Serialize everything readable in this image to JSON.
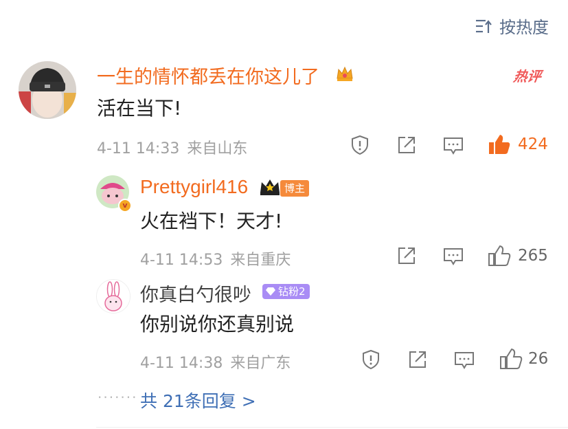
{
  "sort_label": "按热度",
  "main_comment": {
    "username": "一生的情怀都丢在你这儿了",
    "hot_tag": "热评",
    "content": "活在当下!",
    "time": "4-11 14:33",
    "location": "来自山东",
    "likes": "424",
    "accent_color": "#f26b1f"
  },
  "replies": [
    {
      "username": "Prettygirl416",
      "badge": "博主",
      "content": "火在裆下！天才!",
      "time": "4-11 14:53",
      "location": "来自重庆",
      "likes": "265"
    },
    {
      "username": "你真白勺很吵",
      "badge": "钻粉2",
      "content": "你别说你还真别说",
      "time": "4-11 14:38",
      "location": "来自广东",
      "likes": "26"
    }
  ],
  "more_replies": "共 21条回复 >",
  "more_dots": "·······"
}
